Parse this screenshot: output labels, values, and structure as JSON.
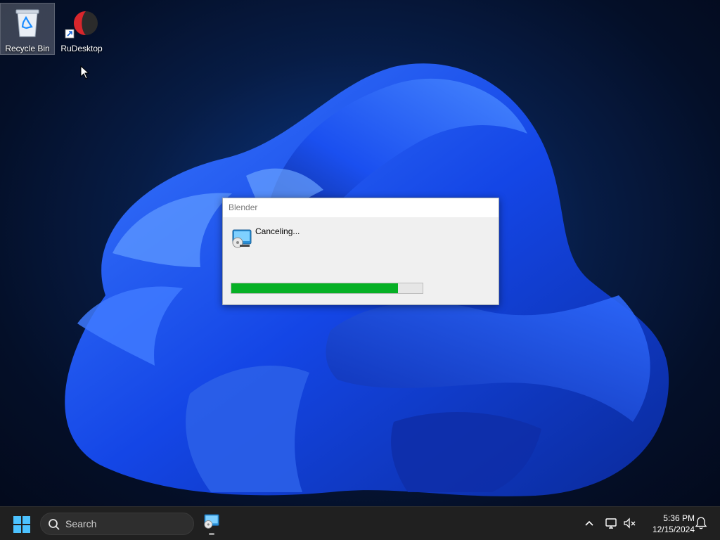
{
  "desktop": {
    "icons": [
      {
        "label": "Recycle Bin",
        "icon": "recycle-bin-icon"
      },
      {
        "label": "RuDesktop",
        "icon": "rudesktop-icon"
      }
    ]
  },
  "dialog": {
    "title": "Blender",
    "status": "Canceling...",
    "icon": "installer-icon",
    "progress": 0.87
  },
  "taskbar": {
    "search_label": "Search",
    "time": "5:36 PM",
    "date": "12/15/2024",
    "icons": [
      "start-icon",
      "search-icon",
      "installer-icon",
      "chevron-up-icon",
      "network-icon",
      "volume-muted-icon",
      "notification-bell-icon"
    ]
  },
  "colors": {
    "progress_fill": "#06b025",
    "taskbar_bg": "#202020",
    "accent_blue": "#1e5eff"
  }
}
